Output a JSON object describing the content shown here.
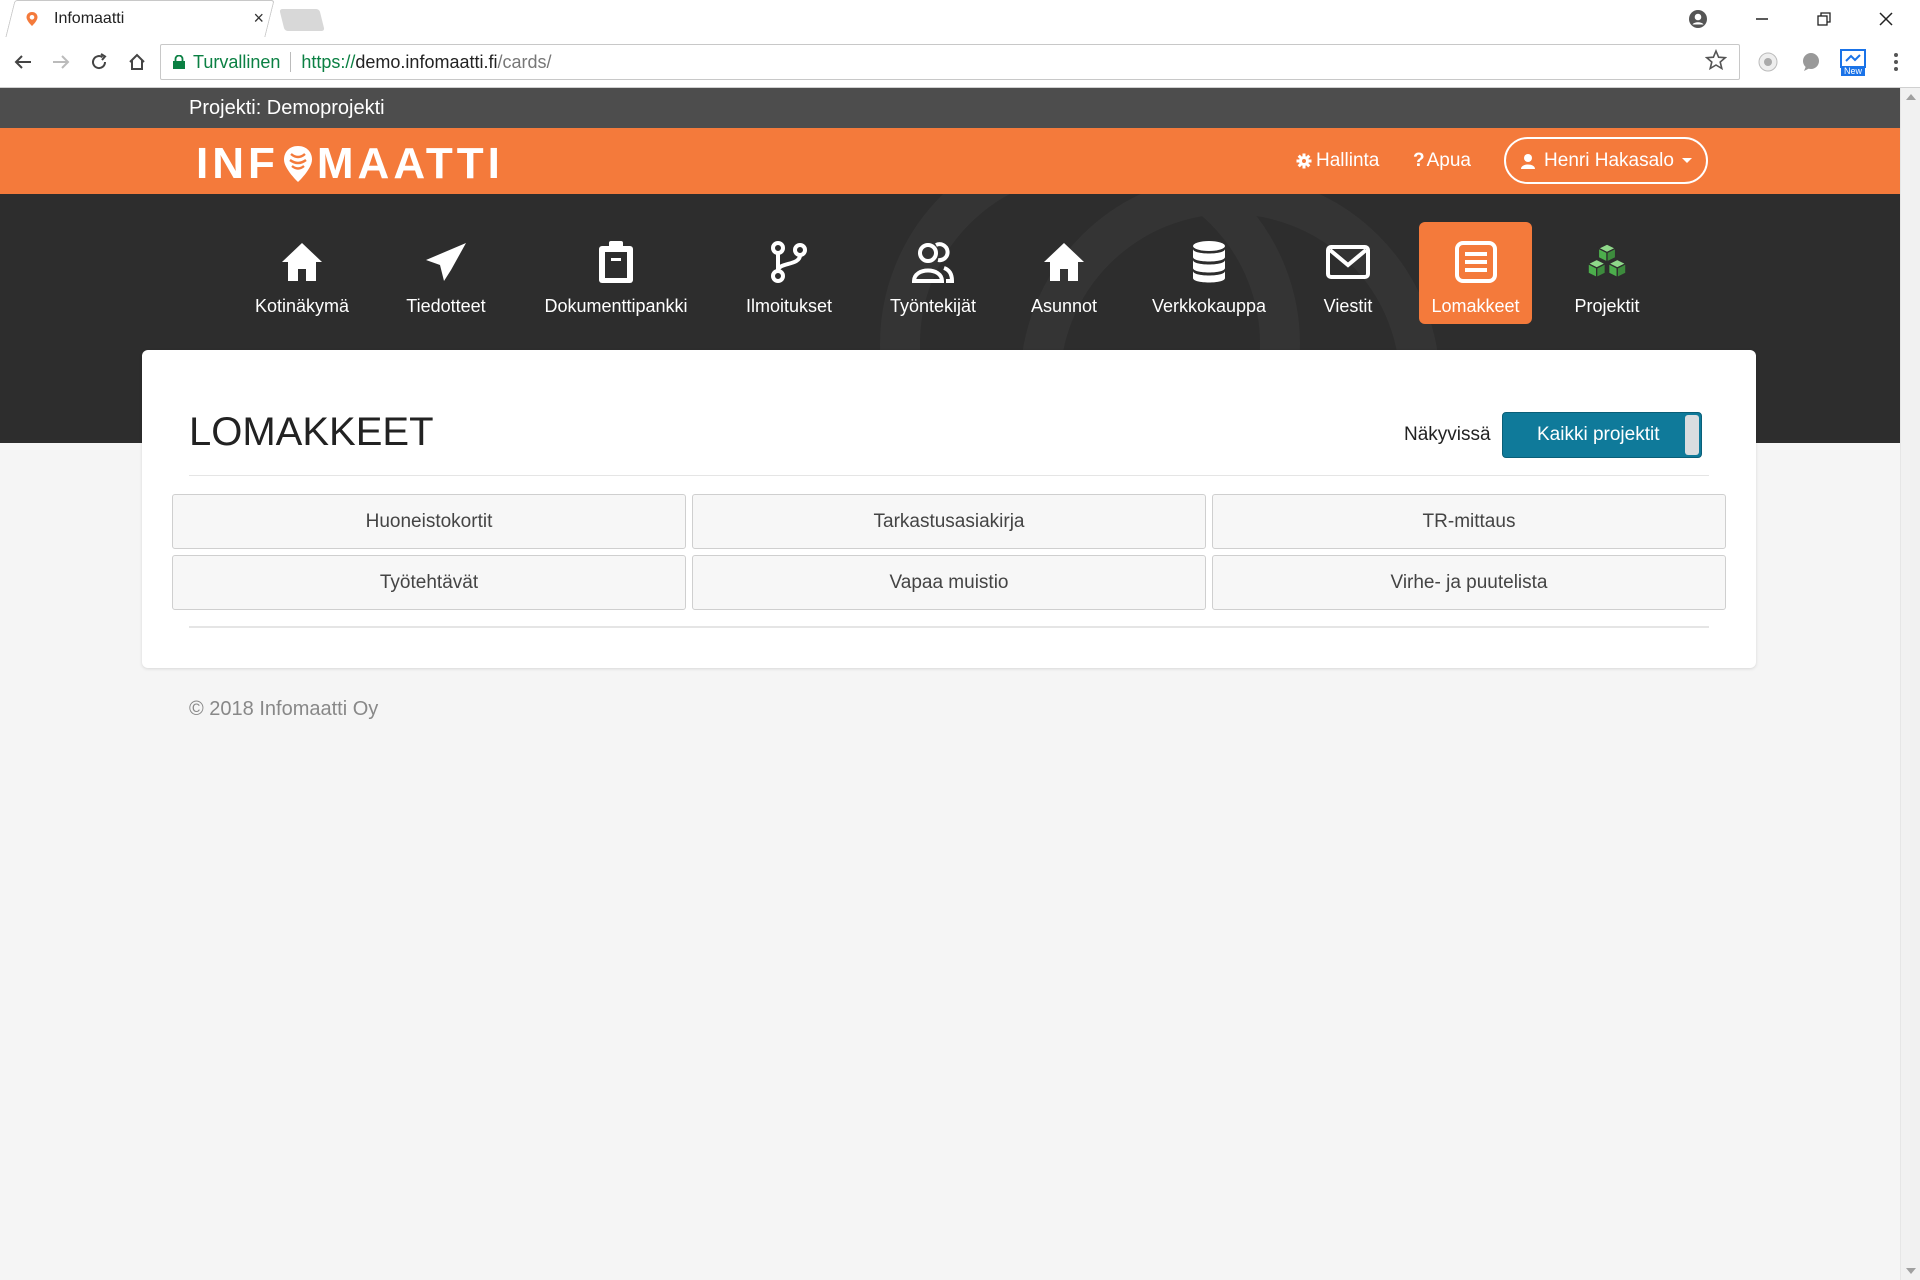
{
  "browser": {
    "tab_title": "Infomaatti",
    "tab_close": "×",
    "secure_label": "Turvallinen",
    "url_scheme": "https://",
    "url_host": "demo.infomaatti.fi",
    "url_path": "/cards/",
    "ext_badge": "New"
  },
  "project_bar": {
    "label": "Projekti: Demoprojekti"
  },
  "header": {
    "logo_left": "INF",
    "logo_right": "MAATTI",
    "admin_label": "Hallinta",
    "help_label": "Apua",
    "user_name": "Henri Hakasalo"
  },
  "nav": {
    "items": [
      {
        "label": "Kotinäkymä",
        "icon": "home-icon"
      },
      {
        "label": "Tiedotteet",
        "icon": "paper-plane-icon"
      },
      {
        "label": "Dokumenttipankki",
        "icon": "clipboard-icon"
      },
      {
        "label": "Ilmoitukset",
        "icon": "branch-icon"
      },
      {
        "label": "Työntekijät",
        "icon": "users-icon"
      },
      {
        "label": "Asunnot",
        "icon": "house-icon"
      },
      {
        "label": "Verkkokauppa",
        "icon": "database-icon"
      },
      {
        "label": "Viestit",
        "icon": "envelope-icon"
      },
      {
        "label": "Lomakkeet",
        "icon": "form-list-icon",
        "active": true
      },
      {
        "label": "Projektit",
        "icon": "cubes-icon"
      }
    ]
  },
  "main": {
    "title": "LOMAKKEET",
    "visible_label": "Näkyvissä",
    "all_projects_label": "Kaikki projektit",
    "forms": [
      "Huoneistokortit",
      "Tarkastusasiakirja",
      "TR-mittaus",
      "Työtehtävät",
      "Vapaa muistio",
      "Virhe- ja puutelista"
    ]
  },
  "footer": {
    "copyright": "© 2018 Infomaatti Oy"
  },
  "colors": {
    "orange": "#f47a3b",
    "dark": "#2d2d2d",
    "teal_button": "#0f7a9a",
    "green_cubes": "#5cb85c"
  }
}
